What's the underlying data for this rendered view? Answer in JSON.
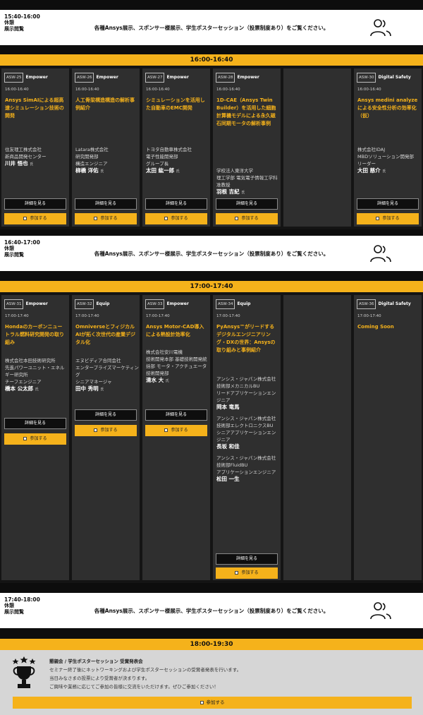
{
  "breaks": [
    {
      "time": "15:40-16:00",
      "lines": [
        "休憩",
        "展示閲覧"
      ],
      "text": "各種Ansys展示、スポンサー様展示、学生ポスターセッション（投票制度あり）をご覧ください。",
      "icon": "people-icon"
    },
    {
      "time": "16:40-17:00",
      "lines": [
        "休憩",
        "展示閲覧"
      ],
      "text": "各種Ansys展示、スポンサー様展示、学生ポスターセッション（投票制度あり）をご覧ください。",
      "icon": "people-icon"
    },
    {
      "time": "17:40-18:00",
      "lines": [
        "休憩",
        "展示閲覧"
      ],
      "text": "各種Ansys展示、スポンサー様展示、学生ポスターセッション（投票制度あり）をご覧ください。",
      "icon": "people-icon"
    }
  ],
  "slots": [
    {
      "label": "16:00-16:40"
    },
    {
      "label": "17:00-17:40"
    },
    {
      "label": "18:00-19:30"
    }
  ],
  "buttons": {
    "detail": "詳細を見る",
    "join": "参加する"
  },
  "sessions_1600": [
    {
      "code": "ASW-25",
      "track": "Empower",
      "time": "16:00-16:40",
      "title": "Ansys SimAIによる超高速シミュレーション技術の開発",
      "org": [
        "住友理工株式会社",
        "新商品開発センター"
      ],
      "name": "川井 悟也",
      "suffix": "氏"
    },
    {
      "code": "ASW-26",
      "track": "Empower",
      "time": "16:00-16:40",
      "title": "人工骨梁構造構造の解析事例紹介",
      "org": [
        "Latara株式会社",
        "研究開発部",
        "構造エンジニア"
      ],
      "name": "柳橋 洋佑",
      "suffix": "氏"
    },
    {
      "code": "ASW-27",
      "track": "Empower",
      "time": "16:00-16:40",
      "title": "シミュレーションを活用した自動車のEMC開発",
      "org": [
        "トヨタ自動車株式会社",
        "電子性能開発部",
        "グループ長"
      ],
      "name": "太田 紘一郎",
      "suffix": "氏"
    },
    {
      "code": "ASW-28",
      "track": "Empower",
      "time": "16:00-16:40",
      "title": "1D-CAE（Ansys Twin Builder）を活用した細胞計算機モデルによる永久磁石同期モータの解析事例",
      "org": [
        "学校法人東洋大学",
        "理工学部 電気電子情報工学科",
        "准教授"
      ],
      "name": "羽根 吉紀",
      "suffix": "氏"
    },
    {
      "code": "ASW-30",
      "track": "Digital Safety",
      "time": "16:00-16:40",
      "title": "Ansys medini analyzeによる安全性分析の効率化（仮）",
      "org": [
        "株式会社IDAJ",
        "MBDソリューション開発部",
        "リーダー"
      ],
      "name": "大田 慈介",
      "suffix": "氏"
    }
  ],
  "sessions_1700": [
    {
      "code": "ASW-31",
      "track": "Empower",
      "time": "17:00-17:40",
      "title": "Hondaのカーボンニュートラル燃料研究開発の取り組み",
      "org": [
        "株式会社本田技術研究所",
        "先進パワーユニット・エネルギー研究所",
        "チーフエンジニア"
      ],
      "name": "橋本 公太郎",
      "suffix": "氏"
    },
    {
      "code": "ASW-32",
      "track": "Equip",
      "time": "17:00-17:40",
      "title": "OmniverseとフィジカルAIが拓く次世代の産業デジタル化",
      "org": [
        "エヌビディア合同会社",
        "エンタープライズマーケティング",
        "シニアマネージャ"
      ],
      "name": "田中 秀明",
      "suffix": "氏"
    },
    {
      "code": "ASW-33",
      "track": "Empower",
      "time": "17:00-17:40",
      "title": "Ansys Motor-CAD導入による熱設計効率化",
      "org": [
        "株式会社安川電機",
        "技術開発本部 基礎技術開発統括部 モータ・アクチュエータ技術開発部"
      ],
      "name": "清水 大",
      "suffix": "氏"
    },
    {
      "code": "ASW-34",
      "track": "Equip",
      "time": "17:00-17:40",
      "title": "PyAnsys™がリードするデジタルエンジニアリング・DXの世界：Ansysの取り組みと事例紹介",
      "speakers": [
        {
          "org": [
            "アンシス・ジャパン株式会社",
            "技術部メカニカルBU",
            "リードアプリケーションエンジニア"
          ],
          "name": "岡本 竜馬"
        },
        {
          "org": [
            "アンシス・ジャパン株式会社",
            "技術部エレクトロニクスBU",
            "シニアアプリケーションエンジニア"
          ],
          "name": "長坂 和佳"
        },
        {
          "org": [
            "アンシス・ジャパン株式会社",
            "技術部FluidBU",
            "アプリケーションエンジニア"
          ],
          "name": "松田 一生"
        }
      ]
    },
    {
      "code": "ASW-36",
      "track": "Digital Safety",
      "time": "17:00-17:40",
      "title": "Coming Soon"
    }
  ],
  "award": {
    "title": "懇親会 / 学生ポスターセッション 受賞発表会",
    "lines": [
      "セミナー終了後にネットワーキングおよび学生ポスターセッションの受賞者発表を行います。",
      "当日みなさまの投票により受賞者が決まります。",
      "ご興味や業務に応じてご参加の皆様に交流をいただけます。ぜひご参加ください！"
    ],
    "icon": "trophy-icon"
  },
  "colors": {
    "accent": "#f5b21b",
    "card": "#2f2f2f",
    "background": "#0d0d0d"
  }
}
